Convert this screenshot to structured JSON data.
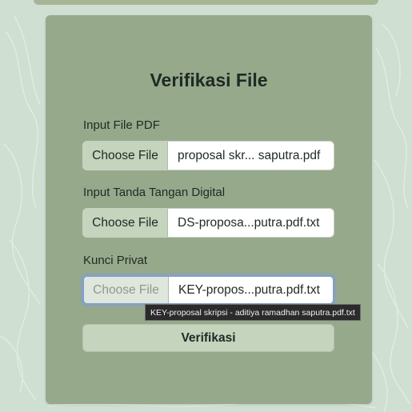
{
  "page": {
    "title": "Verifikasi File"
  },
  "fields": [
    {
      "label": "Input File PDF",
      "button": "Choose File",
      "file": "proposal skr... saputra.pdf"
    },
    {
      "label": "Input Tanda Tangan Digital",
      "button": "Choose File",
      "file": "DS-proposa...putra.pdf.txt"
    },
    {
      "label": "Kunci Privat",
      "button": "Choose File",
      "file": "KEY-propos...putra.pdf.txt"
    }
  ],
  "submit": {
    "label": "Verifikasi"
  },
  "tooltip": {
    "text": "KEY-proposal skripsi - aditiya ramadhan saputra.pdf.txt"
  },
  "colors": {
    "background": "#cfe0d3",
    "card": "#97a98b",
    "button": "#c4d4bd",
    "focus_ring": "#7f9ed0"
  }
}
